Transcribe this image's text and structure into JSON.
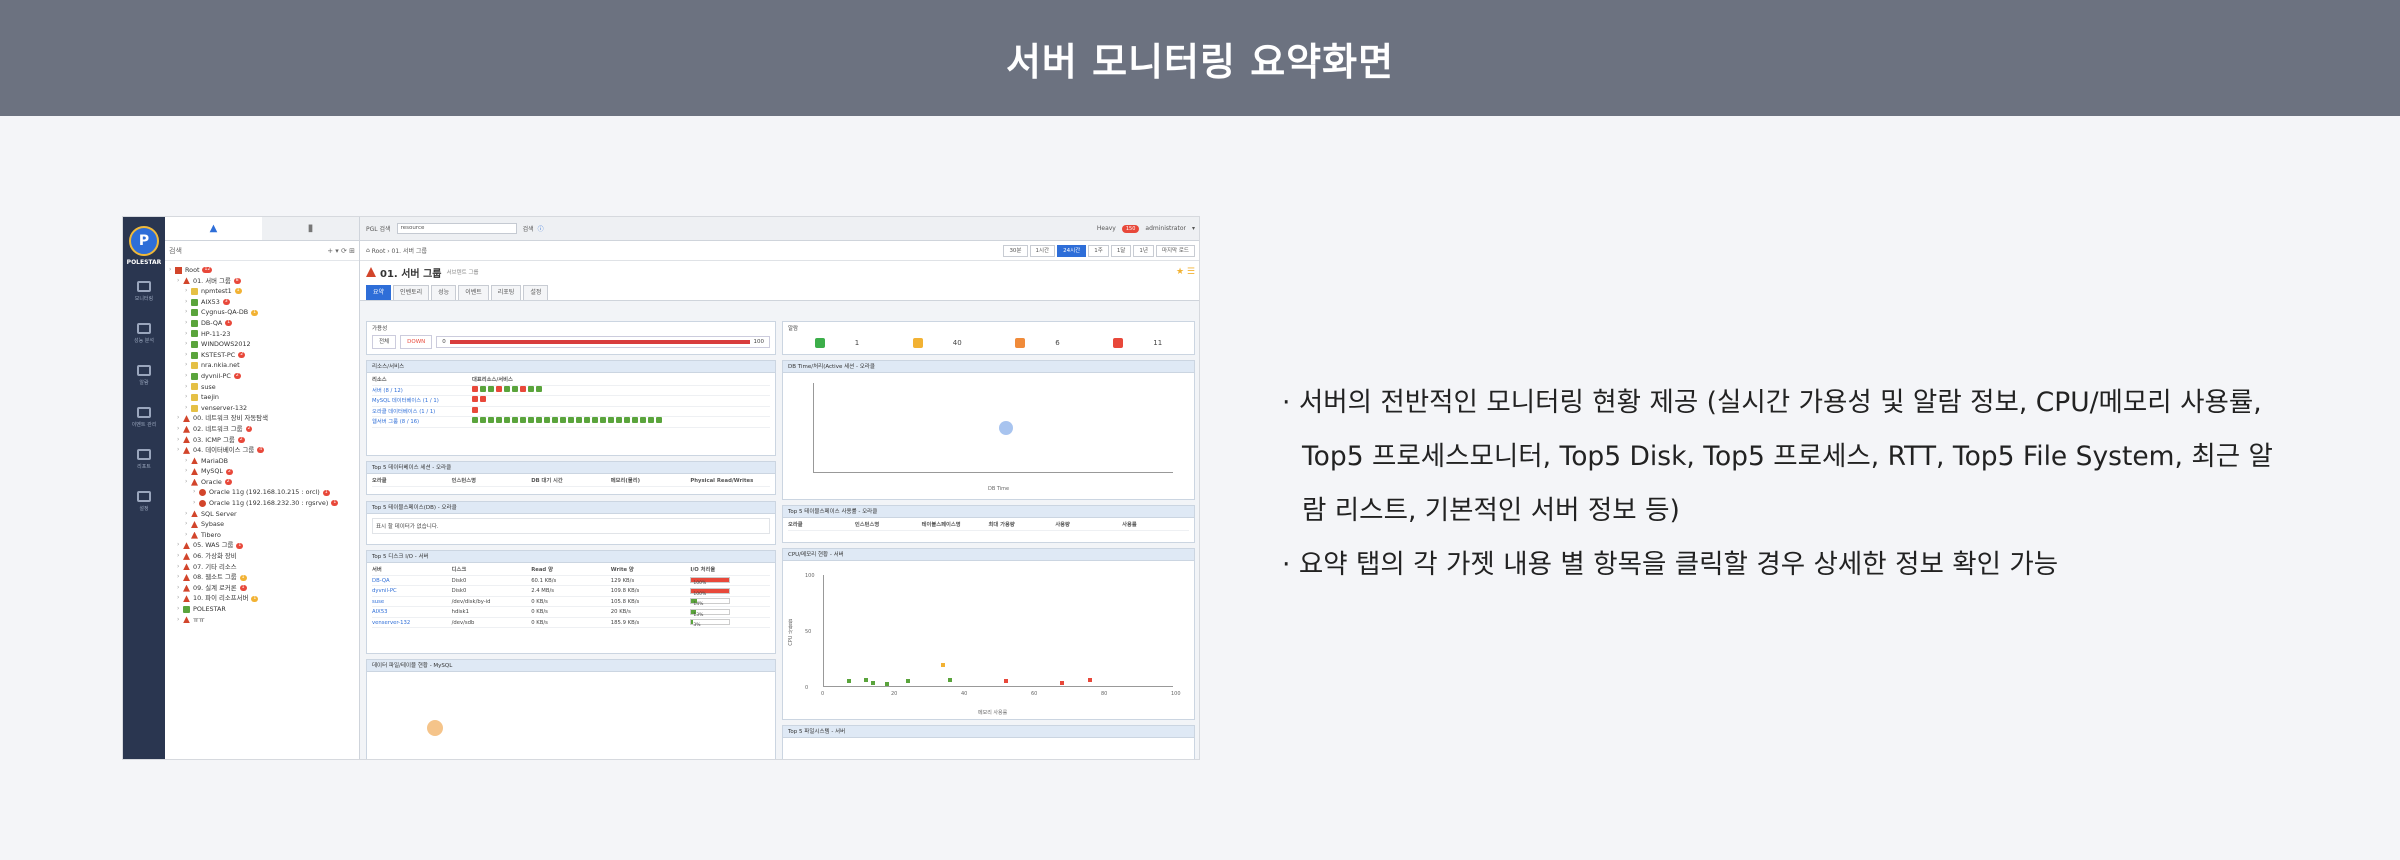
{
  "title": "서버 모니터링 요약화면",
  "bullets": [
    "· 서버의 전반적인 모니터링 현황 제공 (실시간 가용성 및 알람 정보, CPU/메모리 사용률, Top5 프로세스모니터, Top5 Disk, Top5 프로세스, RTT, Top5 File System, 최근 알람 리스트, 기본적인 서버 정보 등)",
    "· 요약 탭의 각 가젯 내용 별 항목을 클릭할 경우 상세한 정보 확인 가능"
  ],
  "app": {
    "logo_text": "POLESTAR",
    "rail": [
      "모니터링",
      "성능 분석",
      "알람",
      "이벤트 관리",
      "리포트",
      "설정"
    ],
    "tree_search": "검색",
    "tree": [
      {
        "label": "Root",
        "type": "home",
        "indent": 0,
        "badge": "12"
      },
      {
        "label": "01. 서버 그룹",
        "type": "grp",
        "indent": 1,
        "badge": "8"
      },
      {
        "label": "npmtest1",
        "type": "off",
        "indent": 2,
        "badge": "1",
        "badge_color": "y"
      },
      {
        "label": "AIX53",
        "type": "srv",
        "indent": 2,
        "badge": "3"
      },
      {
        "label": "Cygnus-QA-DB",
        "type": "srv",
        "indent": 2,
        "badge": "1",
        "badge_color": "y"
      },
      {
        "label": "DB-QA",
        "type": "srv",
        "indent": 2,
        "badge": "1"
      },
      {
        "label": "HP-11-23",
        "type": "srv",
        "indent": 2
      },
      {
        "label": "WINDOWS2012",
        "type": "srv",
        "indent": 2
      },
      {
        "label": "KSTEST-PC",
        "type": "srv",
        "indent": 2,
        "badge": "2"
      },
      {
        "label": "nra.nkia.net",
        "type": "off",
        "indent": 2
      },
      {
        "label": "dyvnil-PC",
        "type": "srv",
        "indent": 2,
        "badge": "2"
      },
      {
        "label": "suse",
        "type": "off",
        "indent": 2
      },
      {
        "label": "taejin",
        "type": "off",
        "indent": 2
      },
      {
        "label": "venserver-132",
        "type": "off",
        "indent": 2
      },
      {
        "label": "00. 네트워크 장비 자동탐색",
        "type": "grp",
        "indent": 1
      },
      {
        "label": "02. 네트워크 그룹",
        "type": "grp",
        "indent": 1,
        "badge": "2"
      },
      {
        "label": "03. ICMP 그룹",
        "type": "grp",
        "indent": 1,
        "badge": "2"
      },
      {
        "label": "04. 데이터베이스 그룹",
        "type": "grp",
        "indent": 1,
        "badge": "4"
      },
      {
        "label": "MariaDB",
        "type": "grp",
        "indent": 2
      },
      {
        "label": "MySQL",
        "type": "grp",
        "indent": 2,
        "badge": "2"
      },
      {
        "label": "Oracle",
        "type": "grp",
        "indent": 2,
        "badge": "2"
      },
      {
        "label": "Oracle 11g (192.168.10.215 : orcl)",
        "type": "db",
        "indent": 3,
        "badge": "1"
      },
      {
        "label": "Oracle 11g (192.168.232.30 : rgsrve)",
        "type": "db",
        "indent": 3,
        "badge": "1"
      },
      {
        "label": "SQL Server",
        "type": "grp",
        "indent": 2
      },
      {
        "label": "Sybase",
        "type": "grp",
        "indent": 2
      },
      {
        "label": "Tibero",
        "type": "grp",
        "indent": 2
      },
      {
        "label": "05. WAS 그룹",
        "type": "grp",
        "indent": 1,
        "badge": "1"
      },
      {
        "label": "06. 가상화 장비",
        "type": "grp",
        "indent": 1
      },
      {
        "label": "07. 기타 리소스",
        "type": "grp",
        "indent": 1
      },
      {
        "label": "08. 웹소트 그룹",
        "type": "grp",
        "indent": 1,
        "badge": "1",
        "badge_color": "y"
      },
      {
        "label": "09. 실계 로커론",
        "type": "grp",
        "indent": 1,
        "badge": "1"
      },
      {
        "label": "10. 파이 리소프서버",
        "type": "grp",
        "indent": 1,
        "badge": "1",
        "badge_color": "y"
      },
      {
        "label": "POLESTAR",
        "type": "srv",
        "indent": 1
      },
      {
        "label": "ㅠㅠ",
        "type": "grp",
        "indent": 1
      }
    ],
    "topbar": {
      "search_label": "PGL 검색",
      "search_value": "resource",
      "search_btn": "검색",
      "user": "administrator",
      "heavy": "Heavy",
      "alarm_count": "150"
    },
    "breadcrumb": "Root › 01. 서버 그룹",
    "ranges": [
      "30분",
      "1시간",
      "24시간",
      "1주",
      "1달",
      "1년",
      "마지막 로드"
    ],
    "active_range": 2,
    "page_title": "01. 서버 그룹",
    "page_sub": "서브텐트 그룹",
    "tabs": [
      "요약",
      "인벤토리",
      "성능",
      "이벤트",
      "리포팅",
      "설정"
    ],
    "active_tab": 0,
    "widgets": {
      "avail_title": "가용성",
      "avail_total": "전체",
      "avail_down": "DOWN",
      "avail_min": "0",
      "avail_max": "100",
      "alarm_title": "알람",
      "alarms": [
        {
          "count": "1",
          "color": "#3cae4a"
        },
        {
          "count": "40",
          "color": "#f2b233"
        },
        {
          "count": "6",
          "color": "#f08b3a"
        },
        {
          "count": "11",
          "color": "#e8483a"
        }
      ],
      "resource_title": "리소스/서비스",
      "resource_head": [
        "리소스",
        "대표리소스/서비스"
      ],
      "resource_rows": [
        "서버 (8 / 12)",
        "MySQL 데이터베이스 (1 / 1)",
        "오라클 데이터베이스 (1 / 1)",
        "웹서버 그룹 (8 / 16)"
      ],
      "top5_inst_title": "Top 5 데이터베이스 세션 - 오라클",
      "top5_inst_head": [
        "오라클",
        "인스턴스명",
        "DB 대기 시간",
        "메모리(물리)",
        "Physical Read/Writes"
      ],
      "top5_tbs_title": "Top 5 테이블스페이스(DB) - 오라클",
      "top5_tbs_empty": "표시 할 데이터가 없습니다.",
      "top5_disk_title": "Top 5 디스크 I/O - 서버",
      "top5_disk_head": [
        "서버",
        "디스크",
        "Read 양",
        "Write 양",
        "I/O 처리율"
      ],
      "top5_disk_rows": [
        [
          "DB-QA",
          "Disk0",
          "60.1 KB/s",
          "129 KB/s",
          "100%"
        ],
        [
          "dyvnil-PC",
          "Disk0",
          "2.4 MB/s",
          "109.8 KB/s",
          "100%"
        ],
        [
          "suse",
          "/dev/disk/by-id",
          "0 KB/s",
          "105.8 KB/s",
          "14%"
        ],
        [
          "AIX53",
          "hdisk1",
          "0 KB/s",
          "20 KB/s",
          "13%"
        ],
        [
          "venserver-132",
          "/dev/sdb",
          "0 KB/s",
          "185.9 KB/s",
          "3%"
        ]
      ],
      "mysql_title": "데이터 파일/테이블 현황 - MySQL",
      "dbtime_title": "DB Time/처리(Active 세션 - 오라클",
      "dbtime_xlabel": "DB Time",
      "top5_tbs2_title": "Top 5 테이블스페이스 사용률 - 오라클",
      "top5_tbs2_head": [
        "오라클",
        "인스턴스명",
        "테이블스페이스명",
        "최대 가용량",
        "사용량",
        "사용률"
      ],
      "cpu_title": "CPU/메모리 현황 - 서버",
      "cpu_xlabel": "메모리 사용률",
      "cpu_ylabel": "CPU 사용률",
      "cpu_yticks": [
        "100",
        "50",
        "0"
      ],
      "cpu_xticks": [
        "0",
        "20",
        "40",
        "60",
        "80",
        "100"
      ],
      "bottom_title": "Top 5 파일시스템 - 서버"
    }
  },
  "colors": {
    "banner": "#6c7280",
    "accent": "#2e6ed8",
    "alert": "#e8483a",
    "ok": "#5aa43c"
  }
}
